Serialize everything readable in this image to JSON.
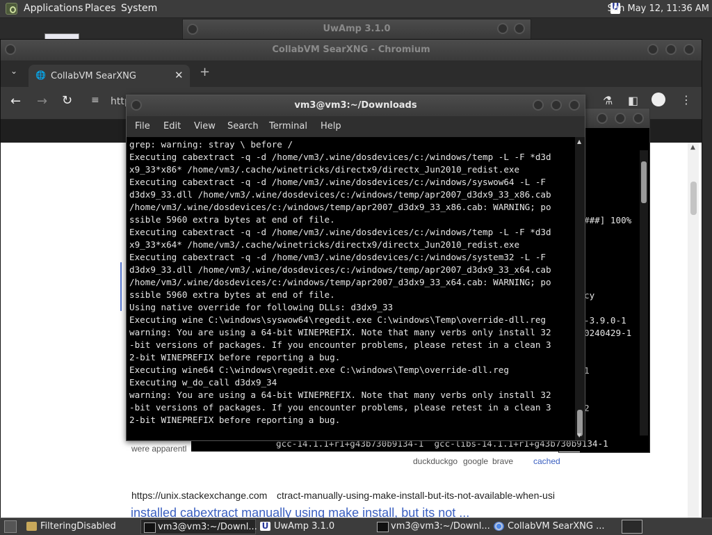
{
  "top_panel": {
    "applications": "Applications",
    "places": "Places",
    "system": "System",
    "clock": "Sun May 12, 11:36 AM"
  },
  "uwamp_window": {
    "title": "UwAmp 3.1.0"
  },
  "chromium": {
    "title": "CollabVM SearXNG - Chromium",
    "tab_title": "CollabVM SearXNG",
    "address_partial": "http",
    "page": {
      "snippet_fragment_1": "were apparentl",
      "engines": [
        "duckduckgo",
        "google",
        "brave"
      ],
      "cached_label": "cached",
      "result_url_host": "https://unix.stackexchange.com",
      "result_url_path": "ctract-manually-using-make-install-but-its-not-available-when-usi",
      "result_title": "installed cabextract manually using make install, but its not ..."
    }
  },
  "back_terminal": {
    "fragments": [
      "###] 100%",
      "cy",
      "-3.9.0-1",
      "0240429-1",
      "1",
      "2"
    ],
    "bottom_line": "gcc-14.1.1+r1+g43b730b9134-1  gcc-libs-14.1.1+r1+g43b730b9134-1"
  },
  "terminal": {
    "title": "vm3@vm3:~/Downloads",
    "menu": [
      "File",
      "Edit",
      "View",
      "Search",
      "Terminal",
      "Help"
    ],
    "lines": [
      "grep: warning: stray \\ before /",
      "Executing cabextract -q -d /home/vm3/.wine/dosdevices/c:/windows/temp -L -F *d3d",
      "x9_33*x86* /home/vm3/.cache/winetricks/directx9/directx_Jun2010_redist.exe",
      "Executing cabextract -q -d /home/vm3/.wine/dosdevices/c:/windows/syswow64 -L -F",
      "d3dx9_33.dll /home/vm3/.wine/dosdevices/c:/windows/temp/apr2007_d3dx9_33_x86.cab",
      "/home/vm3/.wine/dosdevices/c:/windows/temp/apr2007_d3dx9_33_x86.cab: WARNING; po",
      "ssible 5960 extra bytes at end of file.",
      "Executing cabextract -q -d /home/vm3/.wine/dosdevices/c:/windows/temp -L -F *d3d",
      "x9_33*x64* /home/vm3/.cache/winetricks/directx9/directx_Jun2010_redist.exe",
      "Executing cabextract -q -d /home/vm3/.wine/dosdevices/c:/windows/system32 -L -F",
      "d3dx9_33.dll /home/vm3/.wine/dosdevices/c:/windows/temp/apr2007_d3dx9_33_x64.cab",
      "/home/vm3/.wine/dosdevices/c:/windows/temp/apr2007_d3dx9_33_x64.cab: WARNING; po",
      "ssible 5960 extra bytes at end of file.",
      "Using native override for following DLLs: d3dx9_33",
      "Executing wine C:\\windows\\syswow64\\regedit.exe C:\\windows\\Temp\\override-dll.reg",
      "warning: You are using a 64-bit WINEPREFIX. Note that many verbs only install 32",
      "-bit versions of packages. If you encounter problems, please retest in a clean 3",
      "2-bit WINEPREFIX before reporting a bug.",
      "Executing wine64 C:\\windows\\regedit.exe C:\\windows\\Temp\\override-dll.reg",
      "Executing w_do_call d3dx9_34",
      "warning: You are using a 64-bit WINEPREFIX. Note that many verbs only install 32",
      "-bit versions of packages. If you encounter problems, please retest in a clean 3",
      "2-bit WINEPREFIX before reporting a bug."
    ]
  },
  "taskbar": {
    "items": [
      {
        "label": "FilteringDisabled",
        "icon": "folder-icon"
      },
      {
        "label": "vm3@vm3:~/Downl...",
        "icon": "terminal-icon"
      },
      {
        "label": "UwAmp 3.1.0",
        "icon": "uwamp-icon"
      },
      {
        "label": "vm3@vm3:~/Downl...",
        "icon": "terminal-icon"
      },
      {
        "label": "CollabVM SearXNG ...",
        "icon": "chromium-icon"
      }
    ]
  }
}
